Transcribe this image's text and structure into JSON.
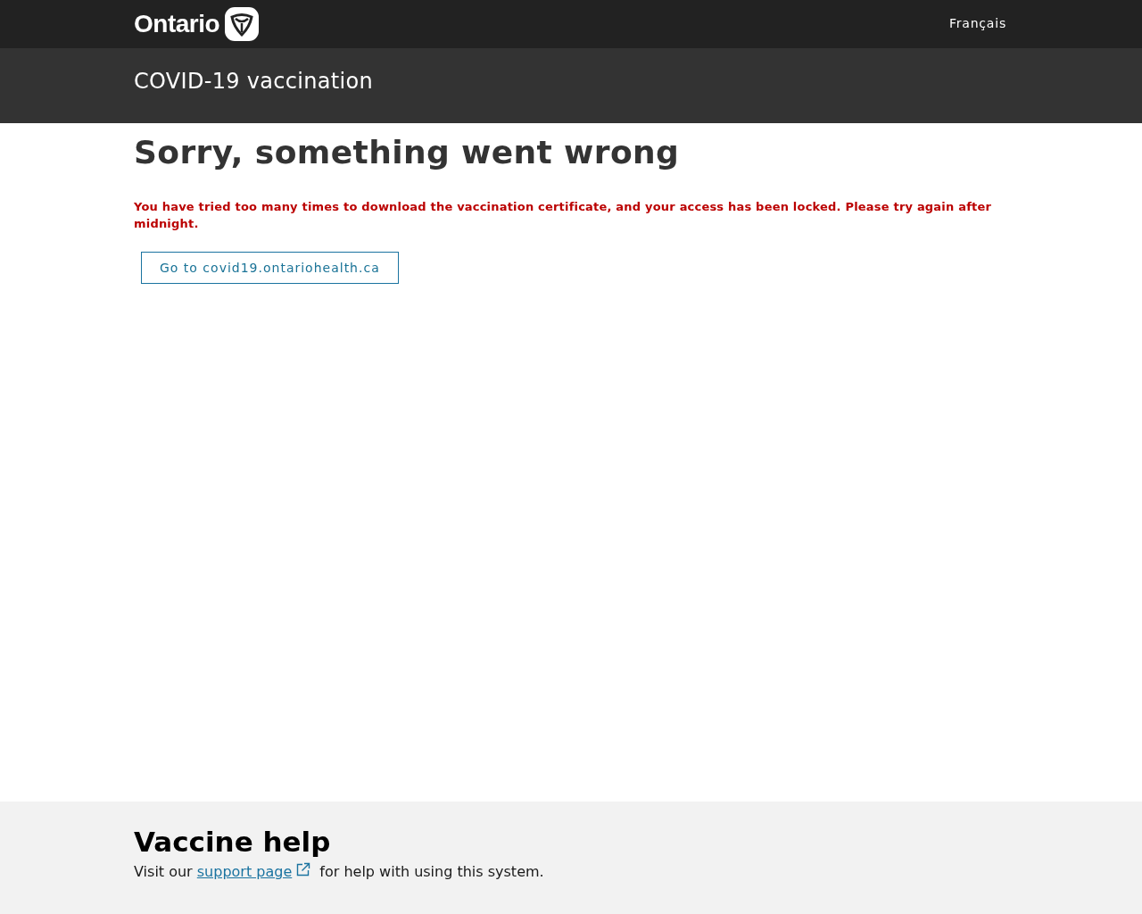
{
  "header": {
    "logo_text": "Ontario",
    "language_link": "Français"
  },
  "banner": {
    "title": "COVID-19 vaccination"
  },
  "main": {
    "heading": "Sorry, something went wrong",
    "error_message": "You have tried too many times to download the vaccination certificate, and your access has been locked. Please try again after midnight.",
    "button": "Go to covid19.ontariohealth.ca"
  },
  "footer": {
    "heading": "Vaccine help",
    "text_before": "Visit our ",
    "link": "support page",
    "text_after": " for help with using this system."
  }
}
